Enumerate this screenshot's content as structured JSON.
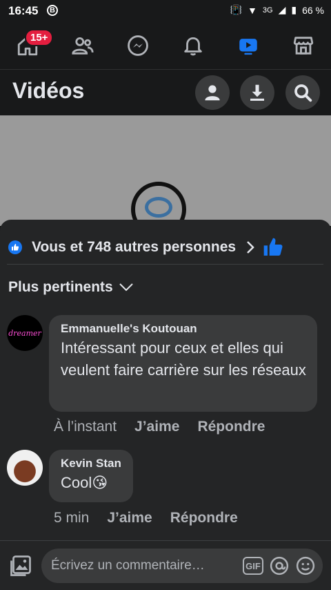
{
  "status_bar": {
    "time": "16:45",
    "b_icon": "B",
    "network": "3G",
    "battery": "66 %"
  },
  "nav": {
    "badge": "15+",
    "items": [
      "home-icon",
      "friends-icon",
      "messenger-icon",
      "bell-icon",
      "video-icon",
      "marketplace-icon"
    ]
  },
  "header": {
    "title": "Vidéos"
  },
  "reactions": {
    "likes_text": "Vous et 748 autres personnes"
  },
  "sort": {
    "label": "Plus pertinents"
  },
  "comments": [
    {
      "author": "Emmanuelle's Koutouan",
      "avatar_text": "dreamer",
      "text": "Intéressant pour ceux et elles qui veulent faire carrière sur les réseaux",
      "time": "À l’instant",
      "like": "J’aime",
      "reply": "Répondre"
    },
    {
      "author": "Kevin Stan",
      "text": "Cool😘",
      "time": "5 min",
      "like": "J’aime",
      "reply": "Répondre"
    }
  ],
  "composer": {
    "placeholder": "Écrivez un commentaire…",
    "gif": "GIF"
  },
  "colors": {
    "accent": "#1877f2",
    "background": "#18191a",
    "sheet": "#242526",
    "bubble": "#3a3b3c",
    "badge": "#e41e3f"
  }
}
